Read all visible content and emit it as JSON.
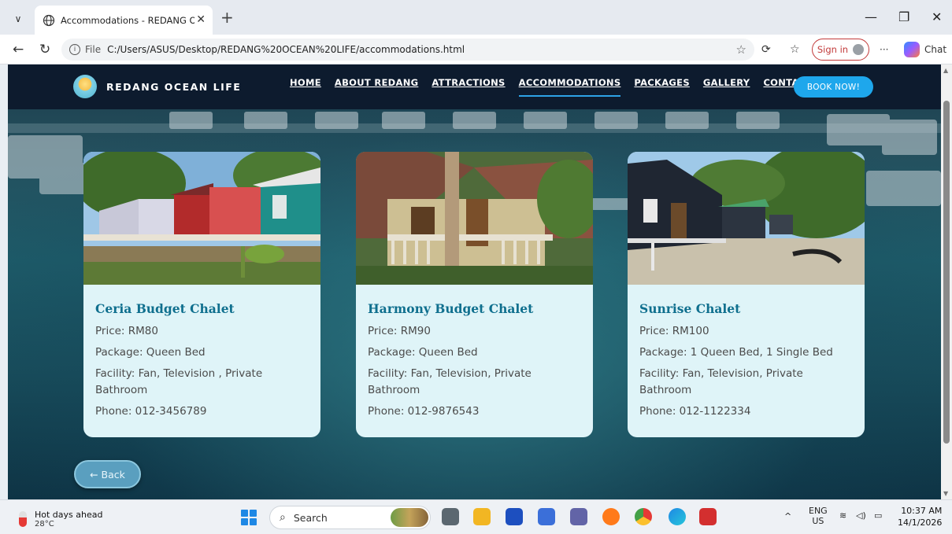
{
  "browser": {
    "tab_title": "Accommodations - REDANG OCEAN LIFE",
    "url_scheme_label": "File",
    "url": "C:/Users/ASUS/Desktop/REDANG%20OCEAN%20LIFE/accommodations.html",
    "signin_label": "Sign in",
    "chat_label": "Chat",
    "more_label": "···"
  },
  "site": {
    "brand": "REDANG OCEAN LIFE",
    "nav": [
      {
        "label": "HOME"
      },
      {
        "label": "ABOUT REDANG"
      },
      {
        "label": "ATTRACTIONS"
      },
      {
        "label": "ACCOMMODATIONS"
      },
      {
        "label": "PACKAGES"
      },
      {
        "label": "GALLERY"
      },
      {
        "label": "CONTACT"
      }
    ],
    "cta": "BOOK NOW!",
    "back_label": "← Back"
  },
  "cards": [
    {
      "name": "Ceria Budget Chalet",
      "price": "Price: RM80",
      "package": "Package: Queen Bed",
      "facility": "Facility: Fan, Television , Private Bathroom",
      "phone": "Phone: 012-3456789"
    },
    {
      "name": "Harmony Budget Chalet",
      "price": "Price: RM90",
      "package": "Package: Queen Bed",
      "facility": "Facility: Fan, Television, Private Bathroom",
      "phone": "Phone: 012-9876543"
    },
    {
      "name": "Sunrise Chalet",
      "price": "Price: RM100",
      "package": "Package: 1 Queen Bed, 1 Single Bed",
      "facility": "Facility: Fan, Television, Private Bathroom",
      "phone": "Phone: 012-1122334"
    }
  ],
  "taskbar": {
    "weather_title": "Hot days ahead",
    "weather_temp": "28°C",
    "search_placeholder": "Search",
    "lang_top": "ENG",
    "lang_bottom": "US",
    "time": "10:37 AM",
    "date": "14/1/2026"
  },
  "colors": {
    "nav_bg": "#0d1b2e",
    "accent": "#1ea7ec",
    "card_bg": "#dff4f8",
    "card_title": "#0f6f8e"
  }
}
